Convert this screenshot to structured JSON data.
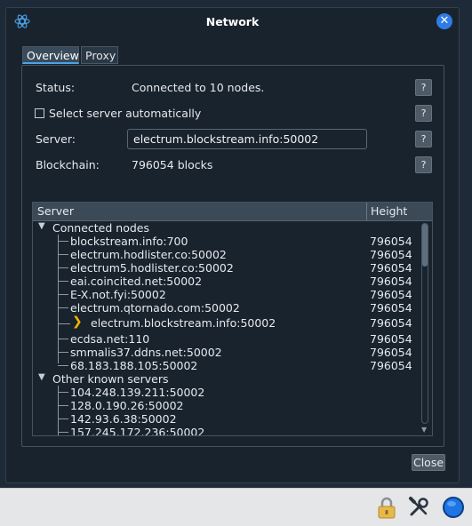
{
  "window": {
    "title": "Network",
    "close_icon": "close-icon"
  },
  "tabs": [
    {
      "label": "Overview",
      "selected": true
    },
    {
      "label": "Proxy",
      "selected": false
    }
  ],
  "overview": {
    "status_label": "Status:",
    "status_value": "Connected to 10 nodes.",
    "auto_select_label": "Select server automatically",
    "auto_select_checked": false,
    "server_label": "Server:",
    "server_value": "electrum.blockstream.info:50002",
    "blockchain_label": "Blockchain:",
    "blockchain_value": "796054 blocks",
    "help_label": "?"
  },
  "tree": {
    "columns": [
      "Server",
      "Height"
    ],
    "connected_label": "Connected nodes",
    "connected": [
      {
        "name": "blockstream.info:700",
        "height": "796054"
      },
      {
        "name": "electrum.hodlister.co:50002",
        "height": "796054"
      },
      {
        "name": "electrum5.hodlister.co:50002",
        "height": "796054"
      },
      {
        "name": "eai.coincited.net:50002",
        "height": "796054"
      },
      {
        "name": "E-X.not.fyi:50002",
        "height": "796054"
      },
      {
        "name": "electrum.qtornado.com:50002",
        "height": "796054"
      },
      {
        "name": "electrum.blockstream.info:50002",
        "height": "796054",
        "current": true
      },
      {
        "name": "ecdsa.net:110",
        "height": "796054"
      },
      {
        "name": "smmalis37.ddns.net:50002",
        "height": "796054"
      },
      {
        "name": "68.183.188.105:50002",
        "height": "796054"
      }
    ],
    "other_label": "Other known servers",
    "other": [
      {
        "name": "104.248.139.211:50002"
      },
      {
        "name": "128.0.190.26:50002"
      },
      {
        "name": "142.93.6.38:50002"
      },
      {
        "name": "157.245.172.236:50002"
      }
    ]
  },
  "buttons": {
    "close_label": "Close"
  },
  "statusbar": {
    "icons": [
      "lock-icon",
      "preferences-icon",
      "network-status-icon"
    ]
  },
  "colors": {
    "accent": "#2f7ce6",
    "current_marker": "#f5b400",
    "background": "#19232d"
  }
}
